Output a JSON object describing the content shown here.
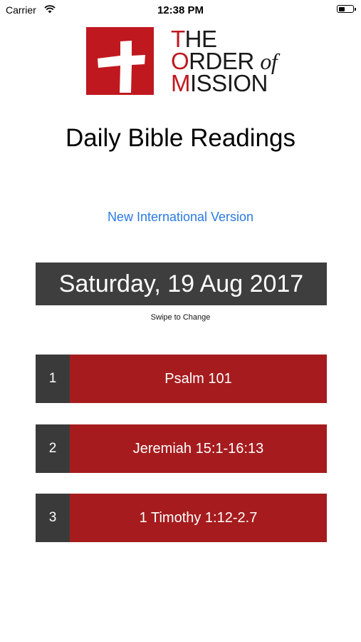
{
  "status_bar": {
    "carrier": "Carrier",
    "time": "12:38 PM"
  },
  "logo": {
    "line1_initial": "T",
    "line1_rest": "HE",
    "line2_initial": "O",
    "line2_rest": "RDER",
    "line2_of": "of",
    "line3_initial": "M",
    "line3_rest": "ISSION",
    "brand_red": "#c0181f"
  },
  "page_title": "Daily Bible Readings",
  "version_link": "New International Version",
  "date": {
    "label": "Saturday, 19 Aug 2017",
    "hint": "Swipe to Change"
  },
  "readings": [
    {
      "number": "1",
      "reference": "Psalm 101"
    },
    {
      "number": "2",
      "reference": "Jeremiah 15:1-16:13"
    },
    {
      "number": "3",
      "reference": "1 Timothy 1:12-2.7"
    }
  ],
  "colors": {
    "reading_red": "#a61c1e",
    "dark_gray": "#3e3e3e",
    "link_blue": "#2a7ae2"
  }
}
